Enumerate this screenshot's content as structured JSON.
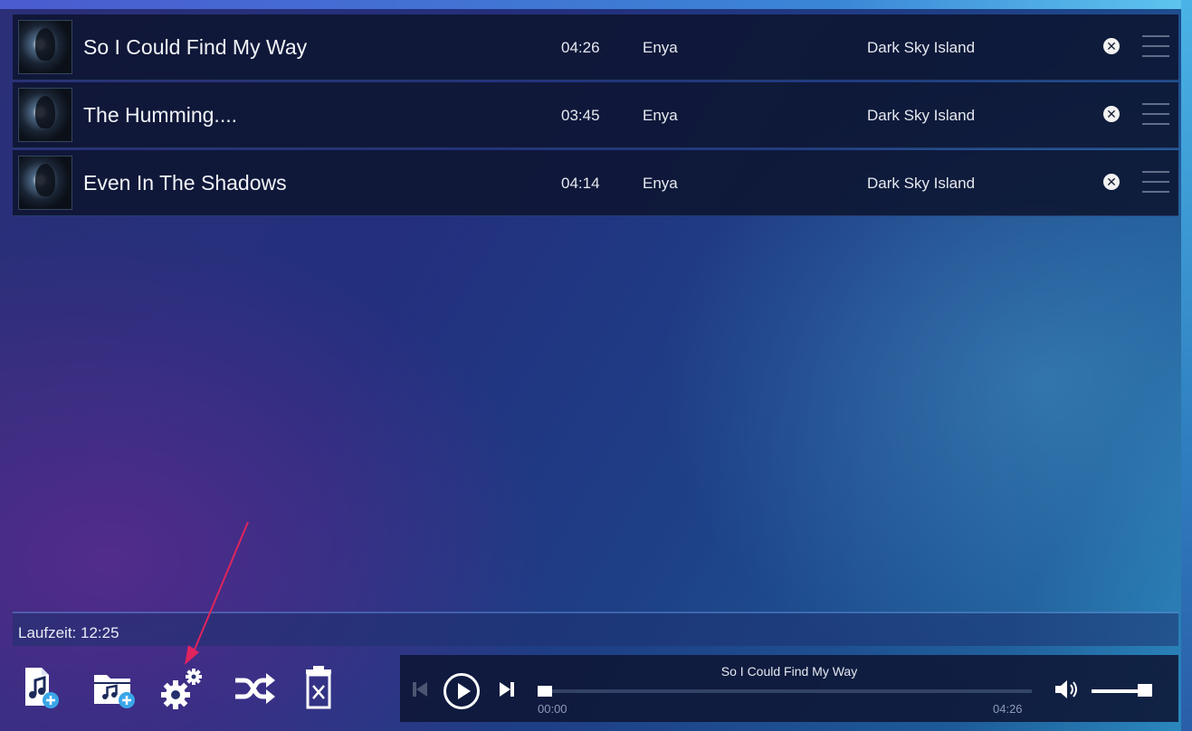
{
  "playlist": {
    "tracks": [
      {
        "title": "So I Could Find My Way",
        "duration": "04:26",
        "artist": "Enya",
        "album": "Dark Sky Island"
      },
      {
        "title": "The Humming....",
        "duration": "03:45",
        "artist": "Enya",
        "album": "Dark Sky Island"
      },
      {
        "title": "Even In The Shadows",
        "duration": "04:14",
        "artist": "Enya",
        "album": "Dark Sky Island"
      }
    ]
  },
  "status": {
    "runtime": "Laufzeit: 12:25"
  },
  "toolbar": {
    "icons": [
      "add-file-icon",
      "add-folder-icon",
      "settings-icon",
      "shuffle-icon",
      "clear-playlist-icon"
    ]
  },
  "player": {
    "now_playing": "So I Could Find My Way",
    "time_current": "00:00",
    "time_total": "04:26",
    "progress": 0.0,
    "volume": 0.95
  },
  "colors": {
    "accent_arrow": "#e0245e",
    "panel": "#0c1430"
  }
}
